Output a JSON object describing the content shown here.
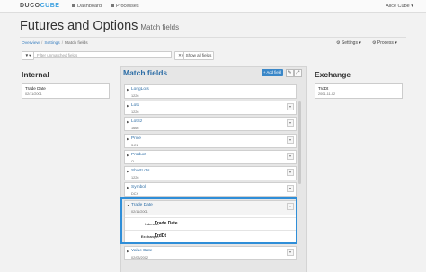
{
  "nav": {
    "logo_a": "DUCO",
    "logo_b": "CUBE",
    "links": [
      "Dashboard",
      "Processes"
    ],
    "user": "Alice Cube ▾"
  },
  "header": {
    "title": "Futures and Options",
    "subtitle": "Match fields"
  },
  "breadcrumb": [
    "Overview",
    "Settings",
    "Match fields"
  ],
  "toolbar": {
    "settings": "Settings ▾",
    "process": "Process ▾"
  },
  "filter": {
    "funnel": "▼▾",
    "placeholder": "Filter unmatched fields",
    "clear": "✕ Clear",
    "show_all": "Show all fields"
  },
  "internal": {
    "title": "Internal",
    "card": {
      "name": "Trade Date",
      "value": "02/11/2001"
    }
  },
  "exchange": {
    "title": "Exchange",
    "card": {
      "name": "TrdDt",
      "value": "2001-11-02"
    }
  },
  "match": {
    "title": "Match fields",
    "add_label": "+ Add field",
    "fields": [
      {
        "name": "LongLots",
        "value": "1226"
      },
      {
        "name": "Lots",
        "value": "1226"
      },
      {
        "name": "LotSz",
        "value": "1666"
      },
      {
        "name": "Price",
        "value": "3.21"
      },
      {
        "name": "Product",
        "value": "O"
      },
      {
        "name": "ShortLots",
        "value": "1226"
      },
      {
        "name": "Symbol",
        "value": "DCX"
      }
    ],
    "expanded": {
      "name": "Trade Date",
      "value": "02/11/2001",
      "internal_label": "Internal:",
      "internal_value": "Trade Date",
      "exchange_label": "Exchange:",
      "exchange_value": "TrdDt"
    },
    "after": {
      "name": "Value Date",
      "value": "02/03/2002"
    }
  },
  "colors": {
    "accent": "#2e6ea6",
    "highlight": "#2f8ed8",
    "button": "#3a87c8"
  }
}
